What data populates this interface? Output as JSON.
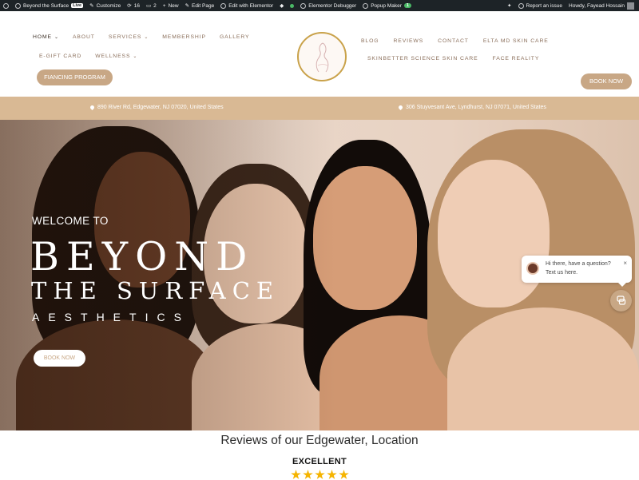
{
  "admin_bar": {
    "site_name": "Beyond the Surface",
    "live_badge": "Live",
    "customize": "Customize",
    "updates_count": "16",
    "comments_count": "2",
    "new_label": "New",
    "edit_page": "Edit Page",
    "edit_elementor": "Edit with Elementor",
    "elementor_debugger": "Elementor Debugger",
    "popup_maker": "Popup Maker",
    "popup_count": "1",
    "report_issue": "Report an issue",
    "howdy": "Howdy, Fayead Hossain"
  },
  "nav_left": [
    {
      "label": "Home",
      "caret": "⌄"
    },
    {
      "label": "About",
      "caret": ""
    },
    {
      "label": "Services",
      "caret": "⌄"
    },
    {
      "label": "Membership",
      "caret": ""
    },
    {
      "label": "Gallery",
      "caret": ""
    },
    {
      "label": "E-Gift Card",
      "caret": ""
    },
    {
      "label": "Wellness",
      "caret": "⌄"
    }
  ],
  "financing_button": "FIANCING PROGRAM",
  "nav_right": [
    {
      "label": "Blog"
    },
    {
      "label": "Reviews"
    },
    {
      "label": "Contact"
    },
    {
      "label": "Elta MD Skin Care"
    },
    {
      "label": "Skinbetter Science Skin Care"
    },
    {
      "label": "Face Reality"
    }
  ],
  "book_now_button": "BOOK NOW",
  "addresses": [
    "890 River Rd, Edgewater, NJ 07020, United States",
    "306 Stuyvesant Ave, Lyndhurst, NJ 07071, United States"
  ],
  "hero": {
    "welcome": "WELCOME TO",
    "title_line1": "BEYOND",
    "title_line2": "THE SURFACE",
    "title_line3": "AESTHETICS",
    "book_button": "BOOK NOW"
  },
  "chat": {
    "line1": "Hi there, have a question?",
    "line2": "Text us here.",
    "close": "×"
  },
  "reviews": {
    "title": "Reviews of our Edgewater, Location",
    "rating_label": "EXCELLENT",
    "stars": 5
  },
  "colors": {
    "accent": "#c8a785",
    "address_bar": "#d9b994",
    "admin_bar": "#1d2327",
    "star": "#f5b400"
  }
}
